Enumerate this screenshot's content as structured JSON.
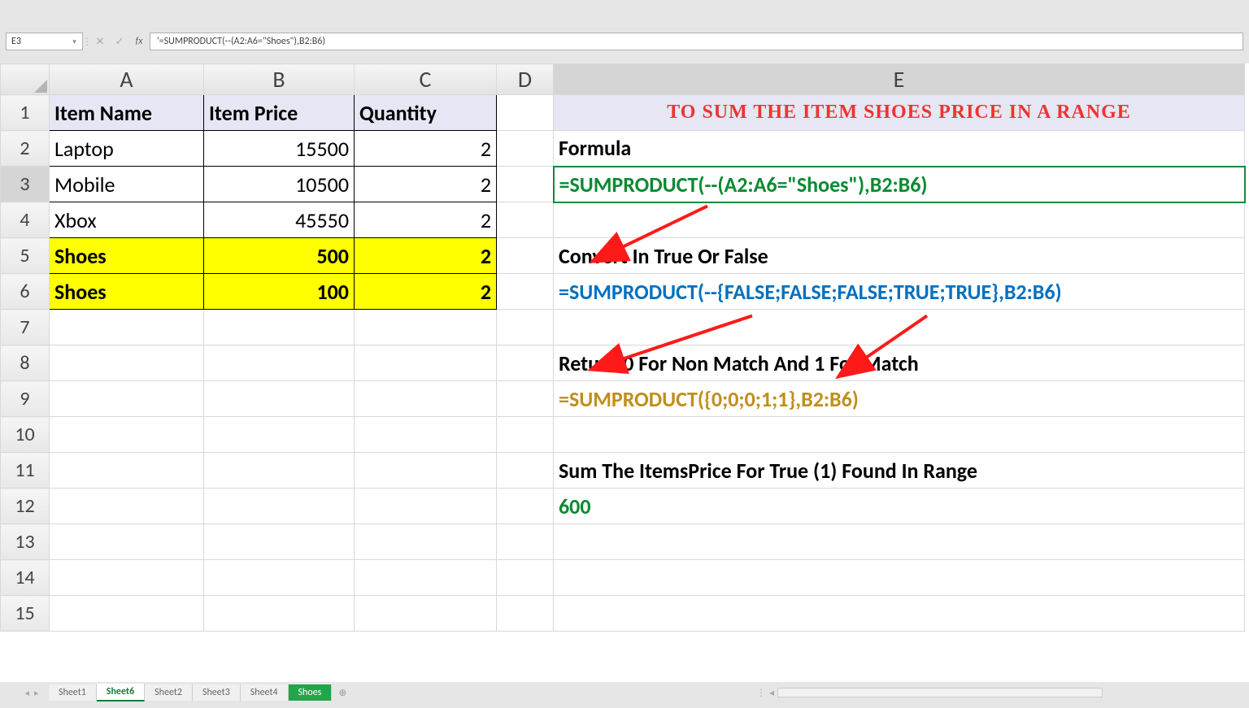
{
  "name_box": "E3",
  "formula_bar": "'=SUMPRODUCT(--(A2:A6=\"Shoes\"),B2:B6)",
  "columns": [
    "A",
    "B",
    "C",
    "D",
    "E"
  ],
  "rows": [
    "1",
    "2",
    "3",
    "4",
    "5",
    "6",
    "7",
    "8",
    "9",
    "10",
    "11",
    "12",
    "13",
    "14",
    "15"
  ],
  "headers": {
    "a": "Item Name",
    "b": "Item Price",
    "c": "Quantity"
  },
  "data": {
    "r2": {
      "a": "Laptop",
      "b": "15500",
      "c": "2"
    },
    "r3": {
      "a": "Mobile",
      "b": "10500",
      "c": "2"
    },
    "r4": {
      "a": "Xbox",
      "b": "45550",
      "c": "2"
    },
    "r5": {
      "a": "Shoes",
      "b": "500",
      "c": "2"
    },
    "r6": {
      "a": "Shoes",
      "b": "100",
      "c": "2"
    }
  },
  "right": {
    "title": "TO SUM THE ITEM SHOES PRICE IN A RANGE",
    "formula_label": "Formula",
    "formula": "=SUMPRODUCT(--(A2:A6=\"Shoes\"),B2:B6)",
    "convert_label": "Convert In True Or False",
    "convert": "=SUMPRODUCT(--{FALSE;FALSE;FALSE;TRUE;TRUE},B2:B6)",
    "return_label": "Return 0 For Non Match And 1 For Match",
    "return": "=SUMPRODUCT({0;0;0;1;1},B2:B6)",
    "sum_label": "Sum The ItemsPrice For True (1) Found In Range",
    "sum_value": "600"
  },
  "tabs": {
    "sheet1": "Sheet1",
    "sheet6": "Sheet6",
    "sheet2": "Sheet2",
    "sheet3": "Sheet3",
    "sheet4": "Sheet4",
    "shoes": "Shoes"
  },
  "icons": {
    "dropdown": "▾",
    "sep": "⋮",
    "cancel": "✕",
    "confirm": "✓",
    "fx": "fx",
    "nav_left": "◂",
    "nav_right": "▸",
    "add": "⊕",
    "scroll_left": "◂"
  }
}
